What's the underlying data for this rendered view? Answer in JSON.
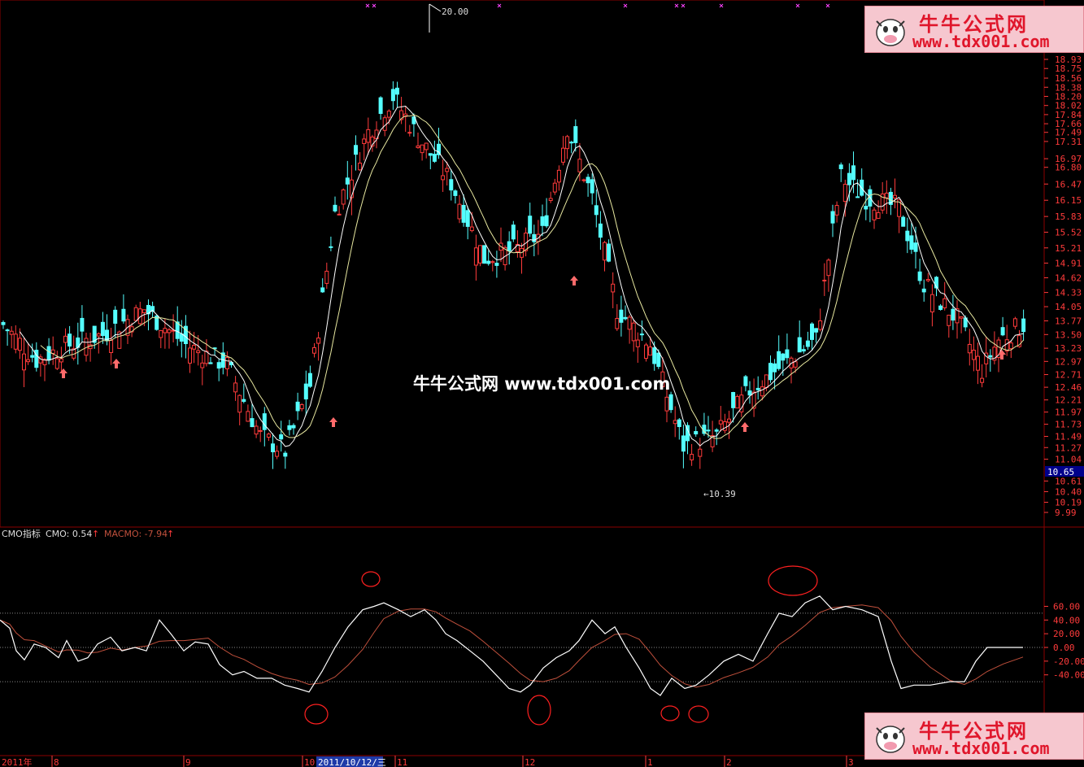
{
  "logo": {
    "title": "牛牛公式网",
    "url": "www.tdx001.com"
  },
  "watermark": "牛牛公式网 www.tdx001.com",
  "price_panel": {
    "price_scale": [
      "18.93",
      "18.75",
      "18.56",
      "18.38",
      "18.20",
      "18.02",
      "17.84",
      "17.66",
      "17.49",
      "17.31",
      "16.97",
      "16.80",
      "16.47",
      "16.15",
      "15.83",
      "15.52",
      "15.21",
      "14.91",
      "14.62",
      "14.33",
      "14.05",
      "13.77",
      "13.50",
      "13.23",
      "12.97",
      "12.71",
      "12.46",
      "12.21",
      "11.97",
      "11.73",
      "11.49",
      "11.27",
      "11.04",
      "10.65",
      "10.61",
      "10.40",
      "10.19",
      "9.99"
    ],
    "current_price": "10.65",
    "high_marker": "20.00",
    "low_marker": "←10.39"
  },
  "indicator_panel": {
    "name": "CMO指标",
    "cmo_label": "CMO: 0.54",
    "macmo_label": "MACMO: -7.94",
    "scale": [
      "60.00",
      "40.00",
      "20.00",
      "0.00",
      "-20.00",
      "-40.00"
    ]
  },
  "date_axis": {
    "labels": [
      "2011年",
      "8",
      "9",
      "10",
      "11",
      "12",
      "1",
      "2",
      "3"
    ],
    "cursor_date": "2011/10/12/三"
  },
  "colors": {
    "up": "#ff3b3b",
    "down": "#54ffff",
    "ma": "#ffffff",
    "ma2": "#e8e8a0",
    "macmo": "#c0503c",
    "grid": "#8b0000",
    "axis": "#ff3b3b"
  },
  "chart_data": {
    "type": "candlestick",
    "cmo_levels": [
      50,
      0,
      -50
    ]
  }
}
